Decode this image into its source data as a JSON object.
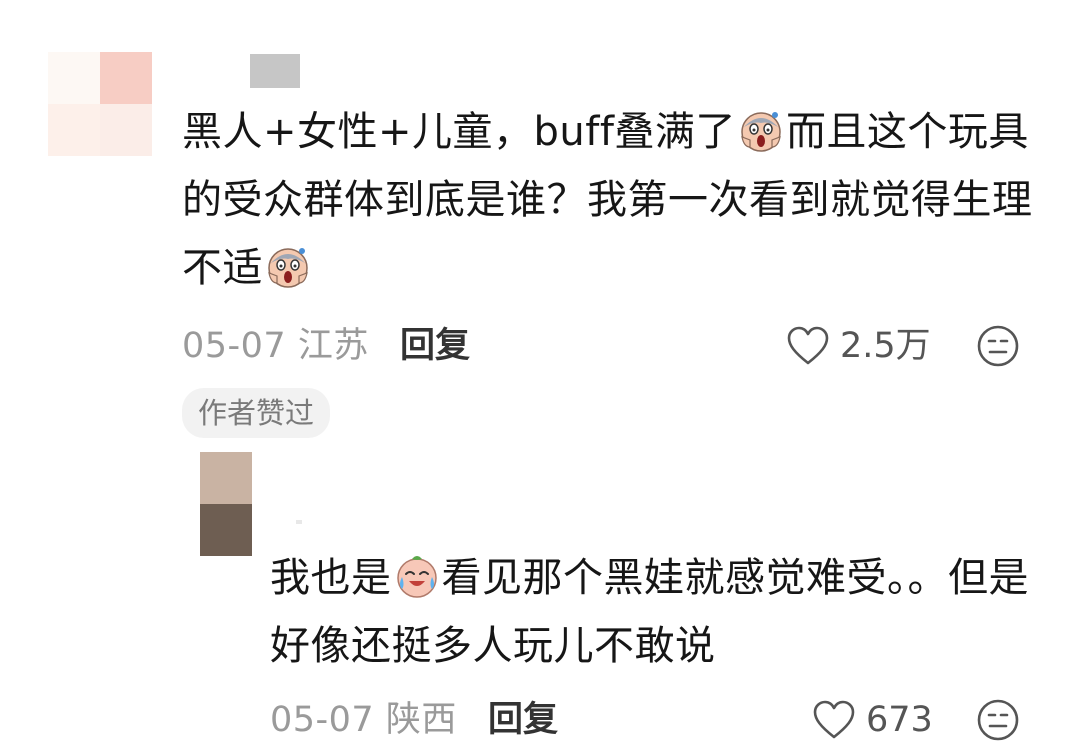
{
  "comments": [
    {
      "text_a": "黑人+女性+儿童，buff叠满了",
      "emoji_a": "scream-face-emoji",
      "text_b": "而且这个玩具的受众群体到底是谁？我第一次看到就觉得生理不适",
      "emoji_b": "scream-face-emoji",
      "date": "05-07",
      "location": "江苏",
      "reply_label": "回复",
      "likes": "2.5万",
      "badge": "作者赞过"
    },
    {
      "text_a": "我也是",
      "emoji_a": "laugh-cry-emoji",
      "text_b": "看见那个黑娃就感觉难受。。但是好像还挺多人玩儿不敢说",
      "date": "05-07",
      "location": "陕西",
      "reply_label": "回复",
      "likes": "673"
    }
  ]
}
